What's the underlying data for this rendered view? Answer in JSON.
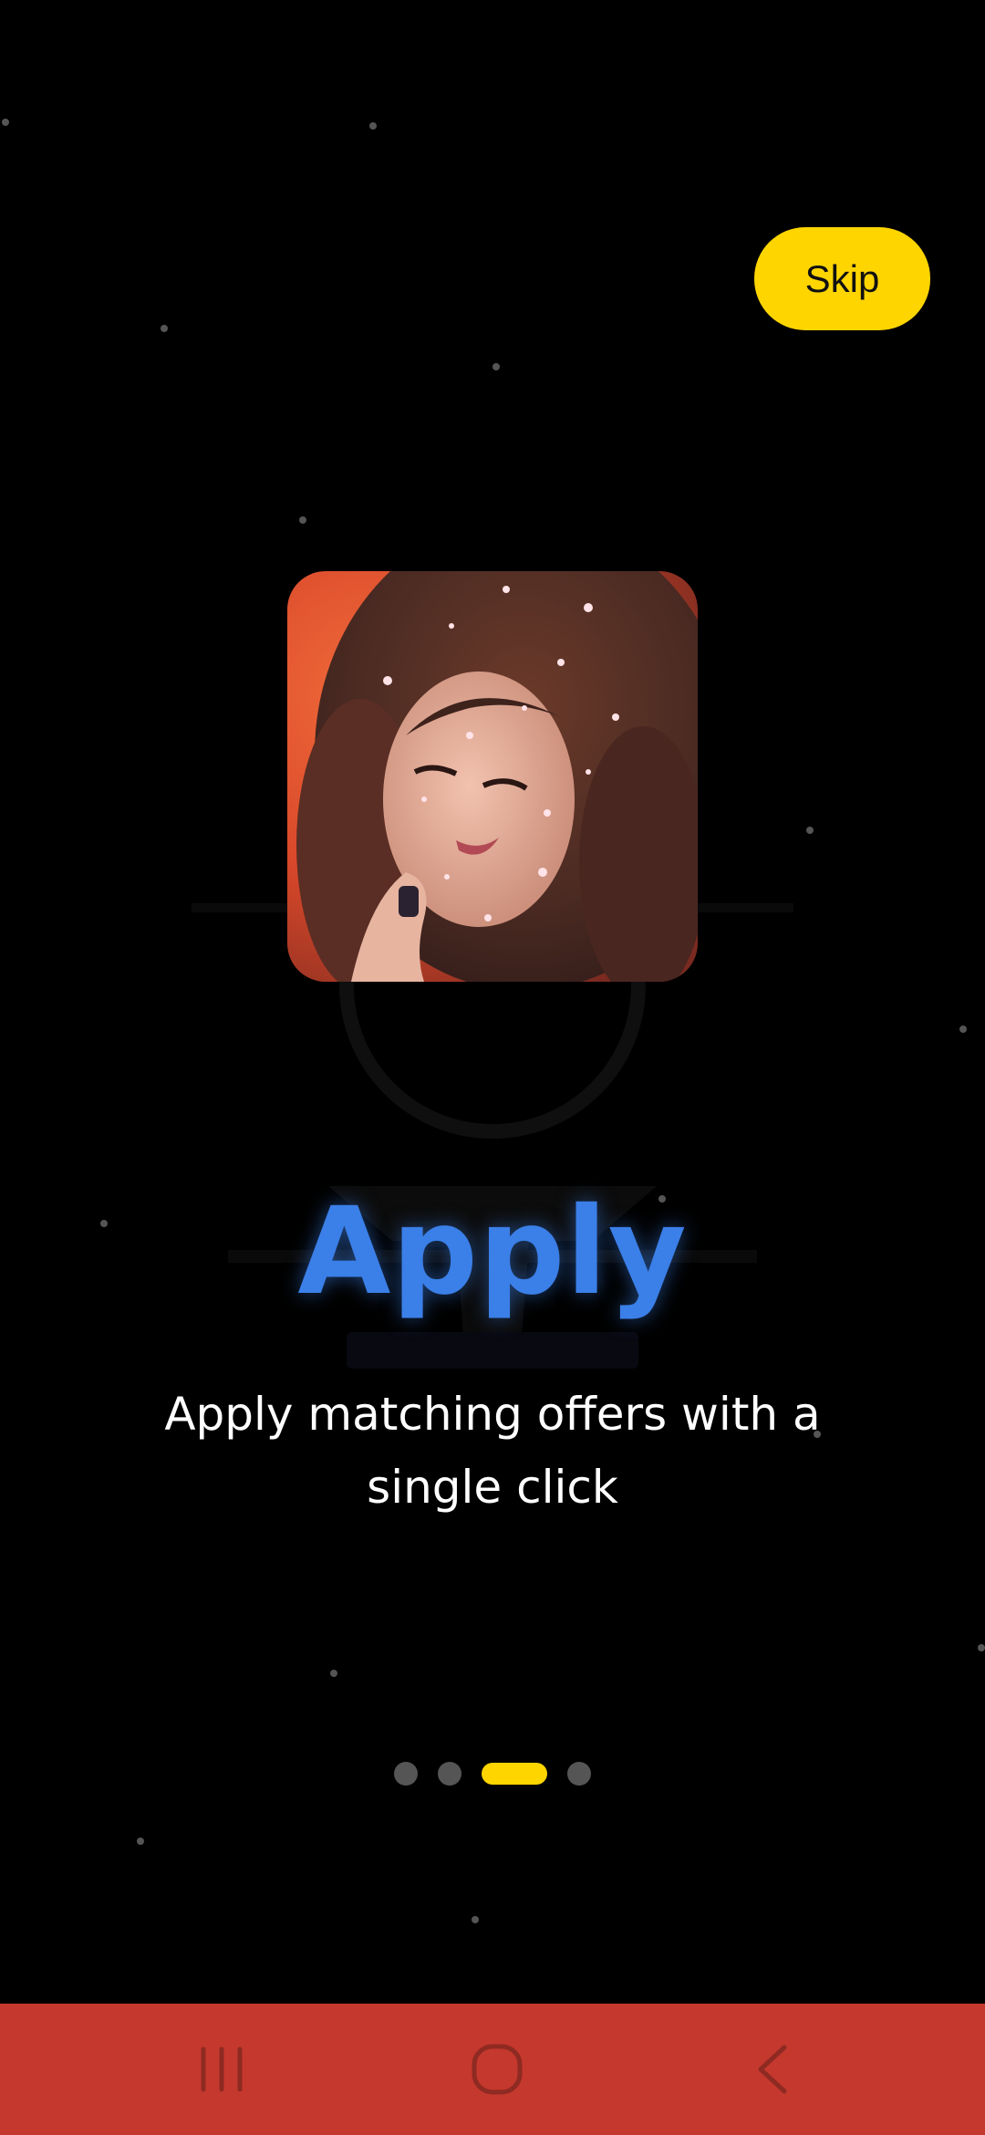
{
  "onboarding": {
    "skip_label": "Skip",
    "title": "Apply",
    "subtitle": "Apply matching offers with a single click",
    "page_index": 3,
    "page_count": 4
  },
  "colors": {
    "accent_yellow": "#FFD500",
    "title_blue": "#3B7FE8",
    "nav_bar": "#C5382D",
    "inactive_dot": "#555555"
  },
  "nav_bar": {
    "recent_icon": "recent-apps-icon",
    "home_icon": "home-icon",
    "back_icon": "back-icon"
  }
}
